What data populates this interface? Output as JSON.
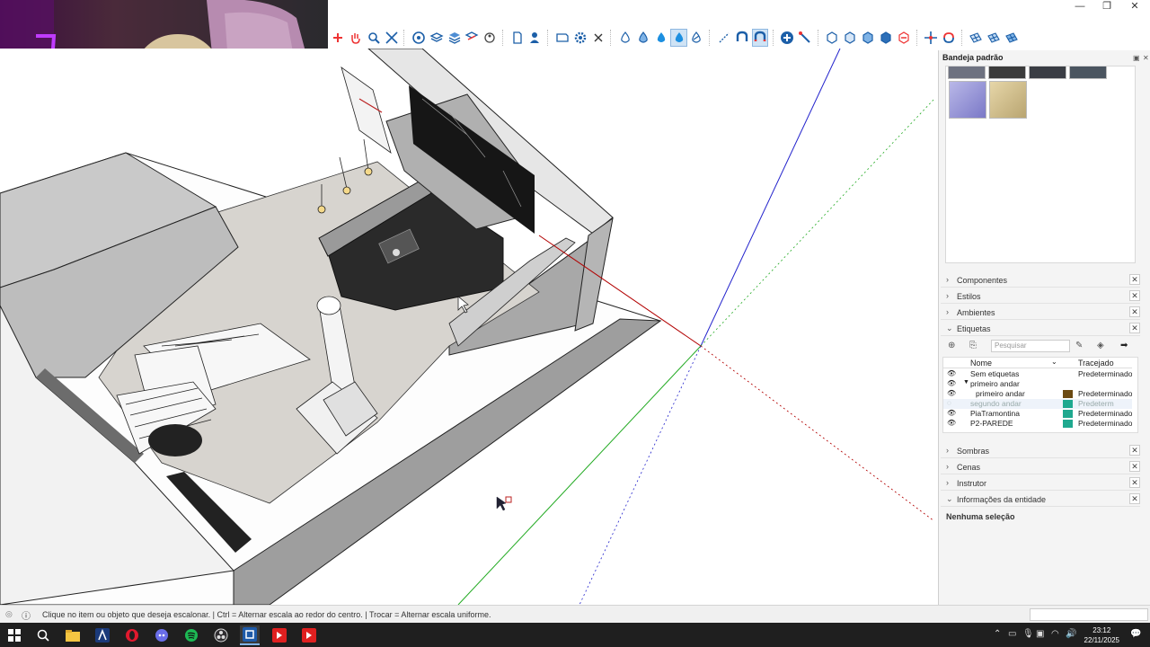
{
  "window": {
    "minimize_glyph": "—",
    "restore_glyph": "❐",
    "close_glyph": "✕"
  },
  "toolbar": {
    "tools": [
      "pan-icon",
      "zoom-window-icon",
      "zoom-extents-icon",
      "orbit-icon",
      "walk-icon",
      "look-around-icon",
      "section-plane-icon",
      "file-icon",
      "user-icon",
      "rectangle-icon",
      "settings-icon",
      "erase-icon",
      "paint-icon",
      "water-drop-icon",
      "water-drop-solid-icon",
      "water-drop-active-icon",
      "water-drop-outline-icon",
      "magnet-icon",
      "magnet-active-icon",
      "add-icon",
      "tape-icon",
      "solid-box-icon",
      "solid-union-icon",
      "solid-subtract-icon",
      "solid-intersect-icon",
      "solid-trim-icon",
      "move-icon",
      "rotate-icon",
      "mesh-icon",
      "mesh-2-icon",
      "mesh-3-icon"
    ]
  },
  "tray": {
    "title": "Bandeja padrão",
    "sections_top": [
      {
        "label": "Componentes",
        "expanded": false
      },
      {
        "label": "Estilos",
        "expanded": false
      },
      {
        "label": "Ambientes",
        "expanded": false
      },
      {
        "label": "Etiquetas",
        "expanded": true
      }
    ],
    "tags": {
      "search_placeholder": "Pesquisar",
      "col_name": "Nome",
      "col_dash": "Tracejado",
      "rows": [
        {
          "name": "Sem etiquetas",
          "dash": "Predeterminado",
          "visible": true,
          "indent": 0,
          "color": ""
        },
        {
          "name": "primeiro andar",
          "dash": "",
          "visible": true,
          "indent": 0,
          "color": "",
          "folder": true
        },
        {
          "name": "primeiro andar",
          "dash": "Predeterminado",
          "visible": true,
          "indent": 1,
          "color": "#6b4a12"
        },
        {
          "name": "segundo andar",
          "dash": "Predeterm",
          "visible": false,
          "indent": 0,
          "color": "#1fa98f"
        },
        {
          "name": "PiaTramontina",
          "dash": "Predeterminado",
          "visible": true,
          "indent": 0,
          "color": "#1fa98f"
        },
        {
          "name": "P2-PAREDE",
          "dash": "Predeterminado",
          "visible": true,
          "indent": 0,
          "color": "#1fa98f"
        }
      ]
    },
    "sections_bottom": [
      {
        "label": "Sombras",
        "expanded": false
      },
      {
        "label": "Cenas",
        "expanded": false
      },
      {
        "label": "Instrutor",
        "expanded": false
      },
      {
        "label": "Informações da entidade",
        "expanded": true
      }
    ],
    "entity_info": "Nenhuma seleção"
  },
  "status": {
    "text": "Clique no item ou objeto que deseja escalonar. | Ctrl = Alternar escala ao redor do centro. | Trocar = Alternar escala uniforme."
  },
  "taskbar": {
    "time": "23:12",
    "date": "22/11/2025"
  }
}
